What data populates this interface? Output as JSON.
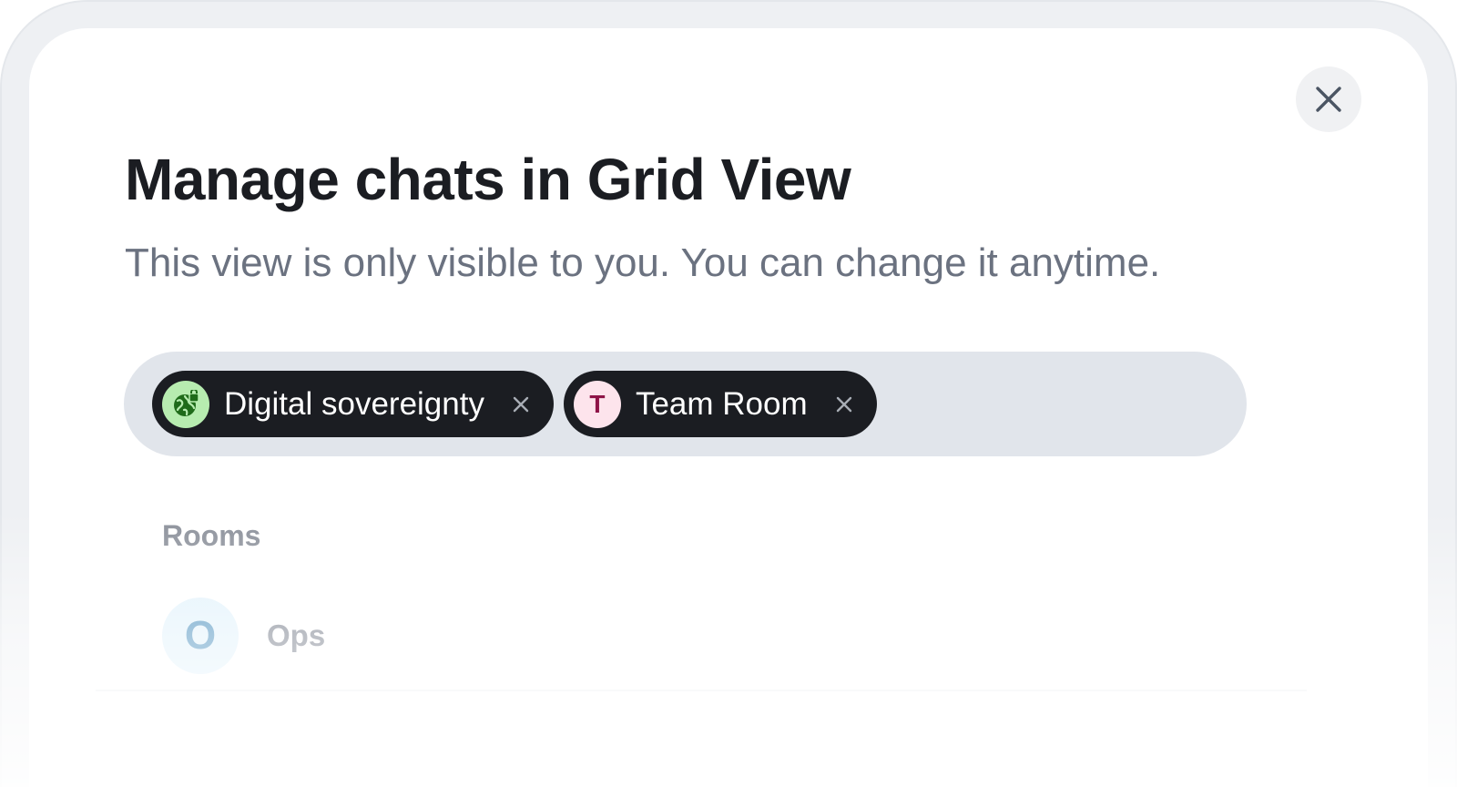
{
  "dialog": {
    "title": "Manage chats in Grid View",
    "subtitle": "This view is only visible to you. You can change it anytime.",
    "close_icon": "close-icon"
  },
  "selected_chats": [
    {
      "label": "Digital sovereignty",
      "avatar_icon": "globe-lock-icon",
      "avatar_color": "#b7ecb0",
      "remove_icon": "close-icon"
    },
    {
      "label": "Team Room",
      "avatar_letter": "T",
      "avatar_color": "#fde4ec",
      "remove_icon": "close-icon"
    }
  ],
  "rooms_section": {
    "label": "Rooms",
    "items": [
      {
        "name": "Ops",
        "avatar_letter": "O",
        "avatar_color": "#dff1fb"
      }
    ]
  }
}
